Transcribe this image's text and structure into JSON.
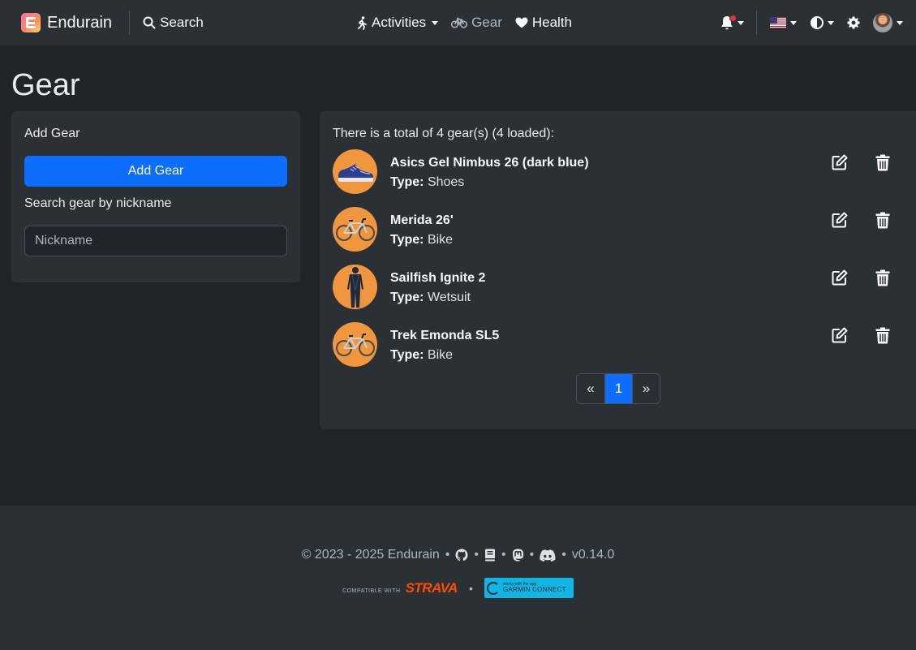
{
  "navbar": {
    "brand": "Endurain",
    "search_label": "Search",
    "activities_label": "Activities",
    "gear_label": "Gear",
    "health_label": "Health"
  },
  "page": {
    "title": "Gear"
  },
  "left_card": {
    "title": "Add Gear",
    "add_button": "Add Gear",
    "search_label": "Search gear by nickname",
    "search_placeholder": "Nickname"
  },
  "gear_list": {
    "total_text": "There is a total of 4 gear(s) (4 loaded):",
    "type_prefix": "Type:",
    "items": [
      {
        "name": "Asics Gel Nimbus 26 (dark blue)",
        "type": "Shoes",
        "icon": "shoe-icon"
      },
      {
        "name": "Merida 26'",
        "type": "Bike",
        "icon": "bicycle-icon"
      },
      {
        "name": "Sailfish Ignite 2",
        "type": "Wetsuit",
        "icon": "wetsuit-icon"
      },
      {
        "name": "Trek Emonda SL5",
        "type": "Bike",
        "icon": "bicycle-icon"
      }
    ]
  },
  "pagination": {
    "prev": "«",
    "current": "1",
    "next": "»"
  },
  "footer": {
    "copyright": "© 2023 - 2025 Endurain",
    "separator": "•",
    "version": "v0.14.0",
    "strava_small": "COMPATIBLE WITH",
    "strava_big": "STRAVA",
    "garmin_small": "works with the app",
    "garmin_big": "GARMIN CONNECT"
  },
  "colors": {
    "background": "#212529",
    "surface": "#2b3035",
    "accent": "#0d6efd",
    "gear_avatar": "#f0963f",
    "notification_dot": "#dc3545"
  }
}
